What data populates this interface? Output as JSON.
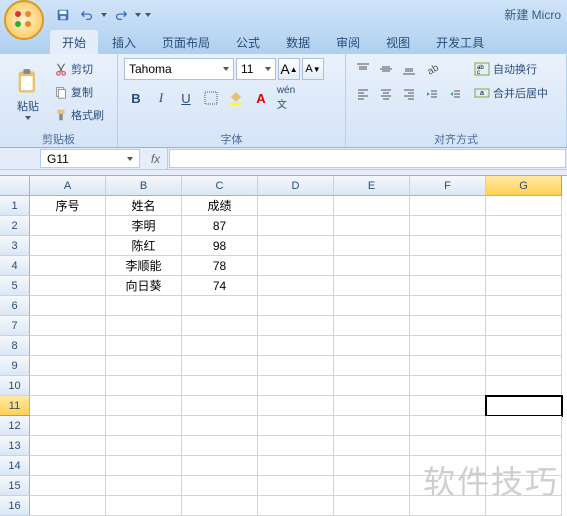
{
  "title": "新建 Micro",
  "tabs": [
    "开始",
    "插入",
    "页面布局",
    "公式",
    "数据",
    "审阅",
    "视图",
    "开发工具"
  ],
  "active_tab": 0,
  "clipboard": {
    "paste": "粘贴",
    "cut": "剪切",
    "copy": "复制",
    "format_painter": "格式刷",
    "group": "剪贴板"
  },
  "font": {
    "name": "Tahoma",
    "size": "11",
    "group": "字体",
    "bold": "B",
    "italic": "I",
    "underline": "U"
  },
  "align": {
    "group": "对齐方式",
    "wrap": "自动换行",
    "merge": "合并后居中"
  },
  "namebox": "G11",
  "columns": [
    "A",
    "B",
    "C",
    "D",
    "E",
    "F",
    "G"
  ],
  "row_count": 16,
  "selected": {
    "row": 11,
    "col": 6
  },
  "chart_data": {
    "type": "table",
    "headers": {
      "A": "序号",
      "B": "姓名",
      "C": "成绩"
    },
    "rows": [
      {
        "B": "李明",
        "C": 87
      },
      {
        "B": "陈红",
        "C": 98
      },
      {
        "B": "李顺能",
        "C": 78
      },
      {
        "B": "向日葵",
        "C": 74
      }
    ]
  },
  "watermark": "软件技巧"
}
